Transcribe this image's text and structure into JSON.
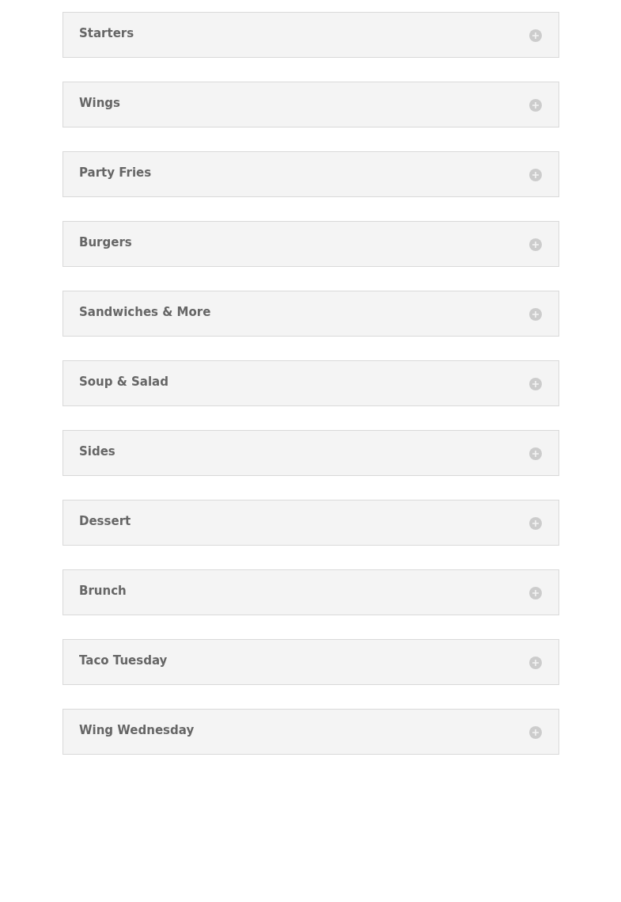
{
  "accordion": [
    {
      "title": "Starters",
      "expanded": false
    },
    {
      "title": "Wings",
      "expanded": false
    },
    {
      "title": "Party Fries",
      "expanded": false
    },
    {
      "title": "Burgers",
      "expanded": false
    },
    {
      "title": "Sandwiches & More",
      "expanded": false
    },
    {
      "title": "Soup & Salad",
      "expanded": false
    },
    {
      "title": "Sides",
      "expanded": false
    },
    {
      "title": "Dessert",
      "expanded": false
    },
    {
      "title": "Brunch",
      "expanded": false
    },
    {
      "title": "Taco Tuesday",
      "expanded": false
    },
    {
      "title": "Wing Wednesday",
      "expanded": false
    }
  ]
}
